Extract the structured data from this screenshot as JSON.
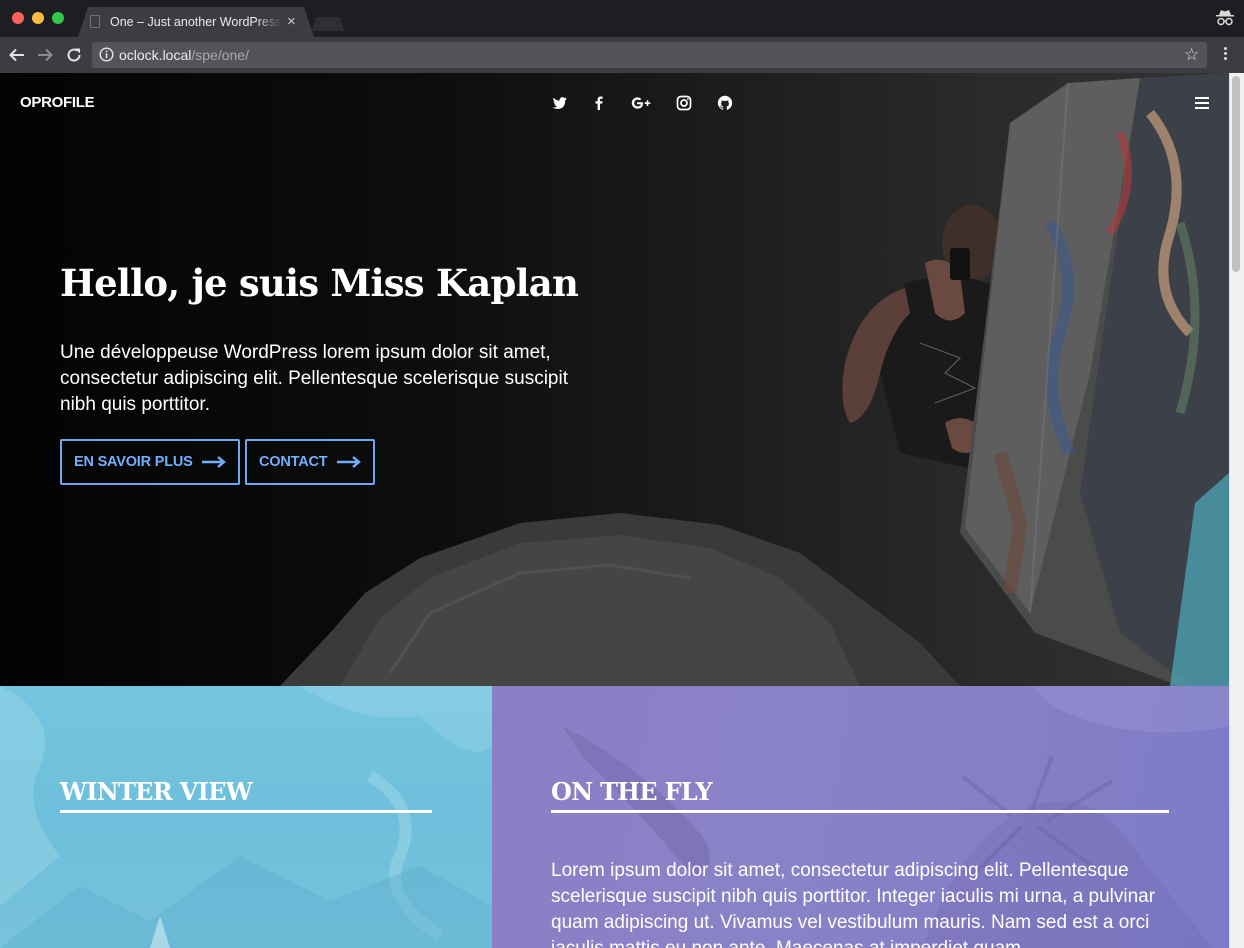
{
  "browser": {
    "tab_title": "One – Just another WordPress site",
    "tab_close": "×",
    "url_host": "oclock.local",
    "url_path": "/spe/one/",
    "star": "☆"
  },
  "site": {
    "logo": "OPROFILE",
    "social_icons": [
      "twitter-icon",
      "facebook-icon",
      "google-plus-icon",
      "instagram-icon",
      "github-icon"
    ],
    "menu_icon": "hamburger-menu-icon"
  },
  "hero": {
    "title": "Hello, je suis Miss Kaplan",
    "text": "Une développeuse WordPress lorem ipsum dolor sit amet, consectetur adipiscing elit. Pellentesque scelerisque suscipit nibh quis porttitor.",
    "buttons": [
      {
        "label": "EN SAVOIR PLUS"
      },
      {
        "label": "CONTACT"
      }
    ]
  },
  "panels": [
    {
      "title": "WINTER VIEW",
      "color": "#74c6e0"
    },
    {
      "title": "ON THE FLY",
      "color": "#8a82c7",
      "text": "Lorem ipsum dolor sit amet, consectetur adipiscing elit. Pellentesque scelerisque suscipit nibh quis porttitor. Integer iaculis mi urna, a pulvinar quam adipiscing ut. Vivamus vel vestibulum mauris. Nam sed est a orci iaculis mattis eu non ante. Maecenas at imperdiet quam."
    }
  ],
  "colors": {
    "accent": "#71b0ff",
    "hero_bg": "#0a0a0a"
  }
}
